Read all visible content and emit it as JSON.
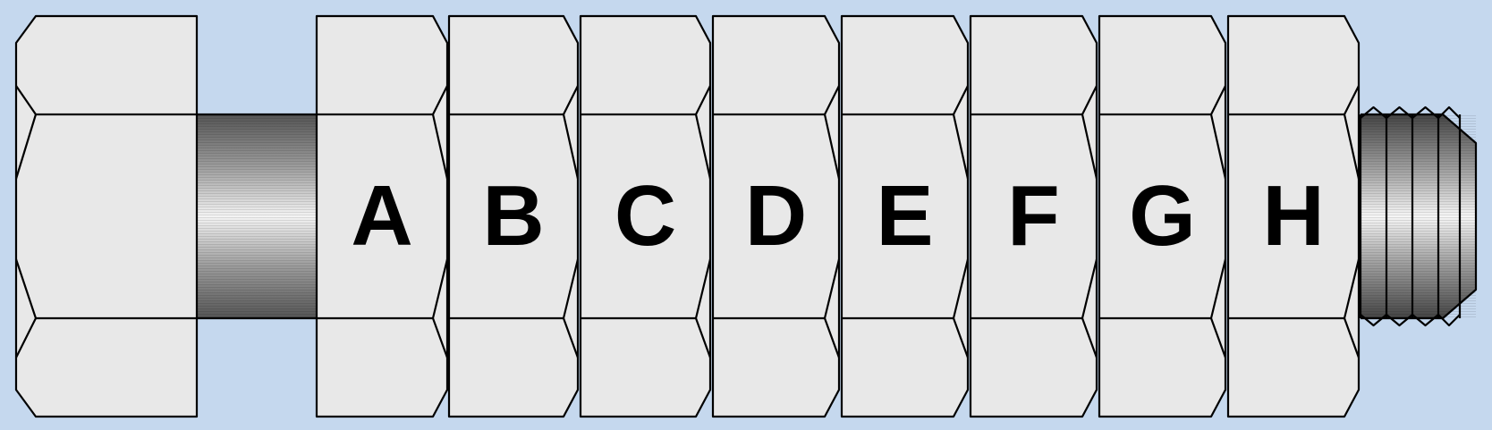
{
  "colors": {
    "background": "#c5d8ee",
    "nut_face": "#e8e8e8",
    "outline": "#000000",
    "shank_dark": "#5a5a5a",
    "shank_light": "#f4f4f4"
  },
  "bolt": {
    "head": {
      "name": "bolt-head"
    },
    "shank": {
      "name": "bolt-shank"
    },
    "thread": {
      "name": "threaded-end"
    }
  },
  "nuts": [
    {
      "id": "A",
      "label": "A"
    },
    {
      "id": "B",
      "label": "B"
    },
    {
      "id": "C",
      "label": "C"
    },
    {
      "id": "D",
      "label": "D"
    },
    {
      "id": "E",
      "label": "E"
    },
    {
      "id": "F",
      "label": "F"
    },
    {
      "id": "G",
      "label": "G"
    },
    {
      "id": "H",
      "label": "H"
    }
  ]
}
